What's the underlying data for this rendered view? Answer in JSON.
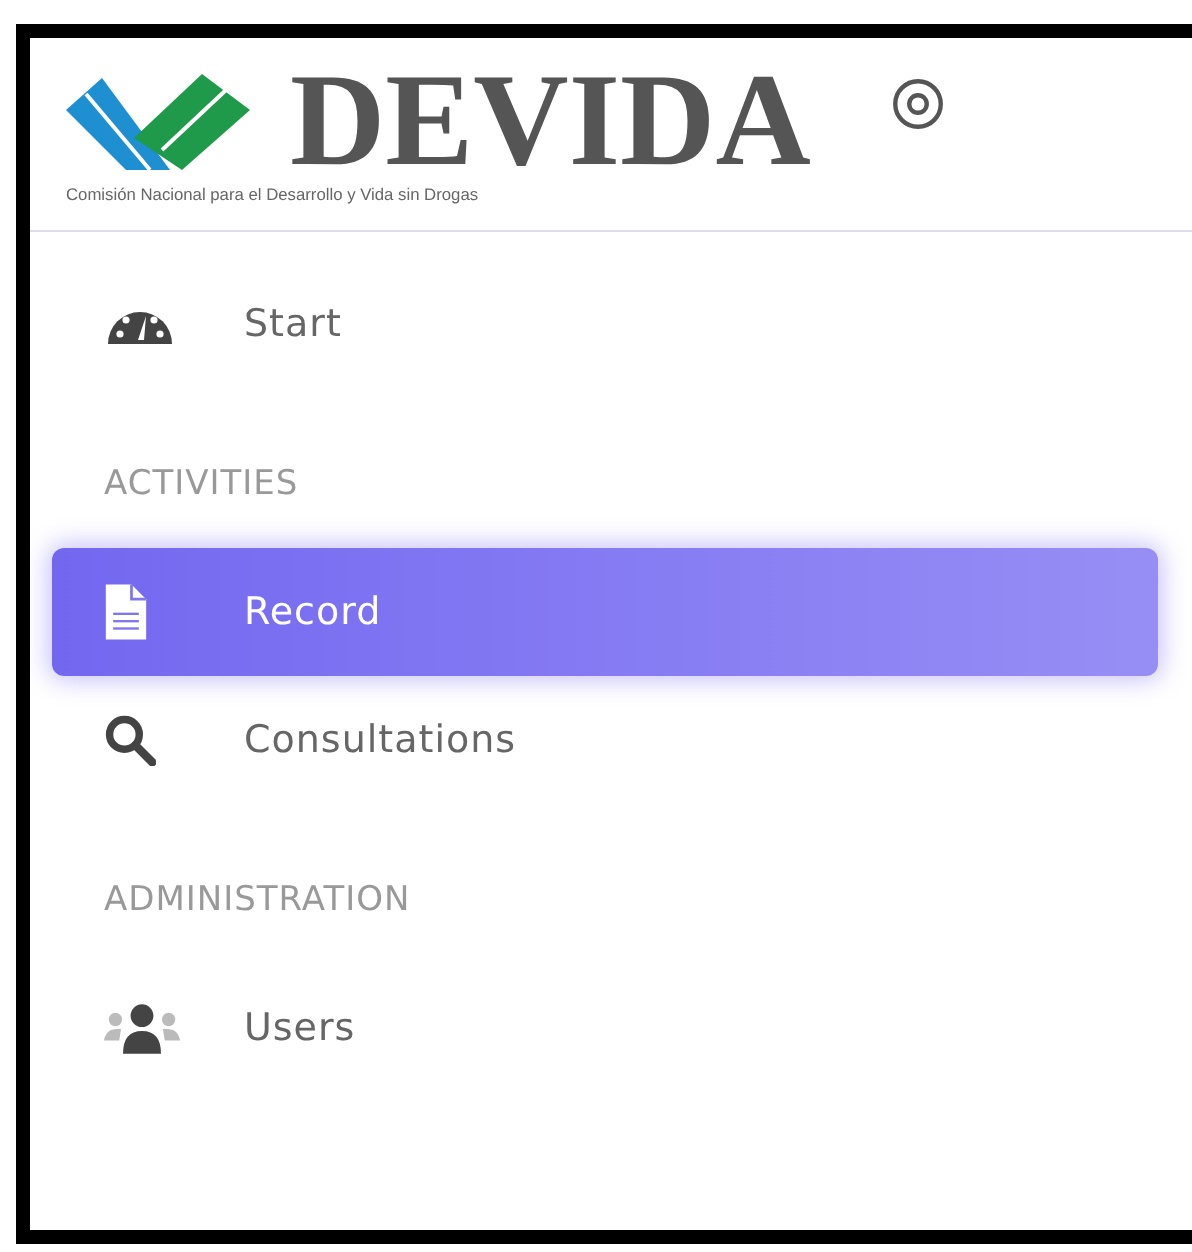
{
  "brand": {
    "name": "DEVIDA",
    "tagline": "Comisión Nacional para el Desarrollo y Vida sin Drogas"
  },
  "sections": [
    {
      "items": [
        {
          "label": "Start",
          "kind": "dashboard",
          "selected": false
        }
      ]
    },
    {
      "heading": "ACTIVITIES",
      "items": [
        {
          "label": "Record",
          "kind": "file",
          "selected": true
        },
        {
          "label": "Consultations",
          "kind": "search",
          "selected": false
        }
      ]
    },
    {
      "heading": "ADMINISTRATION",
      "items": [
        {
          "label": "Users",
          "kind": "users",
          "selected": false
        }
      ]
    }
  ]
}
